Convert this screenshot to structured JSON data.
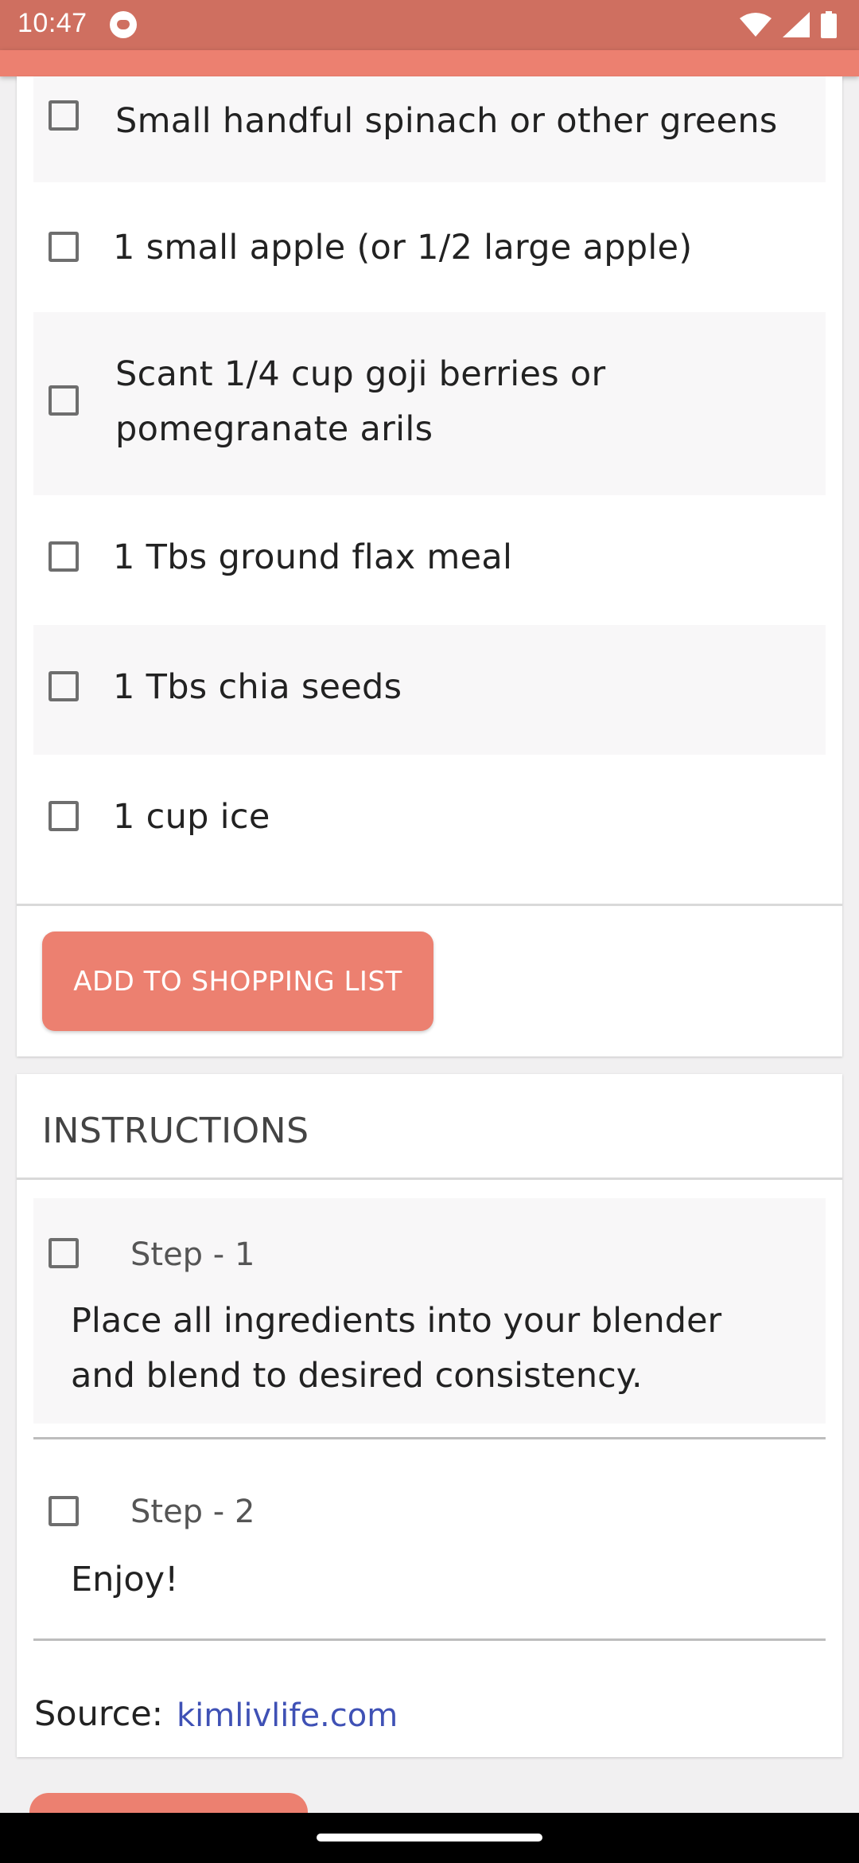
{
  "status_bar": {
    "time": "10:47",
    "icons": [
      "notification-icon",
      "wifi-icon",
      "signal-icon",
      "battery-icon"
    ]
  },
  "ingredients": [
    {
      "text": "Small handful spinach or other greens"
    },
    {
      "text": "1 small apple (or 1/2 large apple)"
    },
    {
      "text": "Scant 1/4 cup goji berries or pomegranate arils"
    },
    {
      "text": "1 Tbs ground flax meal"
    },
    {
      "text": "1 Tbs chia seeds"
    },
    {
      "text": "1 cup ice"
    }
  ],
  "shopping_button_label": "ADD TO SHOPPING LIST",
  "instructions": {
    "title": "INSTRUCTIONS",
    "steps": [
      {
        "label": "Step - 1",
        "text": "Place all ingredients into your blender and blend to desired consistency."
      },
      {
        "label": "Step - 2",
        "text": "Enjoy!"
      }
    ]
  },
  "source": {
    "label": "Source:",
    "link": "kimlivlife.com"
  },
  "colors": {
    "status_bar": "#cf6f60",
    "accent": "#ec8070",
    "link": "#3f51b5"
  }
}
